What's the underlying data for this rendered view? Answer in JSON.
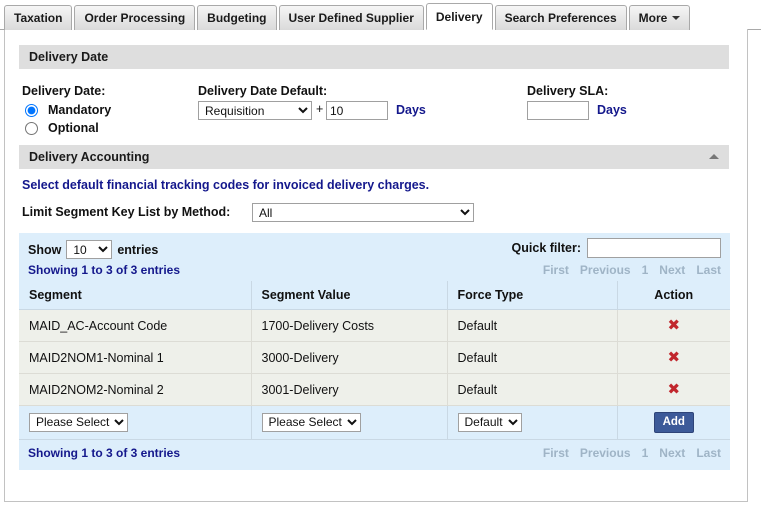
{
  "tabs": [
    {
      "label": "Taxation",
      "active": false
    },
    {
      "label": "Order Processing",
      "active": false
    },
    {
      "label": "Budgeting",
      "active": false
    },
    {
      "label": "User Defined Supplier",
      "active": false
    },
    {
      "label": "Delivery",
      "active": true
    },
    {
      "label": "Search Preferences",
      "active": false
    },
    {
      "label": "More",
      "active": false,
      "has_caret": true
    }
  ],
  "delivery_date_section": {
    "title": "Delivery Date",
    "delivery_date_label": "Delivery Date:",
    "radio_mandatory_label": "Mandatory",
    "radio_optional_label": "Optional",
    "selected_option": "Mandatory",
    "default_label": "Delivery Date Default:",
    "default_value": "Requisition",
    "default_options": [
      "Requisition"
    ],
    "plus_sign": "+",
    "days_offset_value": "10",
    "days_label": "Days",
    "sla_label": "Delivery SLA:",
    "sla_value": "",
    "sla_days_label": "Days"
  },
  "delivery_accounting_section": {
    "title": "Delivery Accounting",
    "collapse_icon": "triangle-up-icon",
    "intro_text": "Select default financial tracking codes for invoiced delivery charges.",
    "limit_label": "Limit Segment Key List by Method:",
    "limit_value": "All",
    "limit_options": [
      "All"
    ]
  },
  "table": {
    "show_prefix": "Show",
    "show_suffix": "entries",
    "page_length": "10",
    "page_length_options": [
      "10"
    ],
    "quick_filter_label": "Quick filter:",
    "quick_filter_value": "",
    "showing_text": "Showing 1 to 3 of 3 entries",
    "pager": [
      "First",
      "Previous",
      "1",
      "Next",
      "Last"
    ],
    "columns": [
      "Segment",
      "Segment Value",
      "Force Type",
      "Action"
    ],
    "rows": [
      {
        "segment": "MAID_AC-Account Code",
        "segment_value": "1700-Delivery Costs",
        "force_type": "Default",
        "action_icon": "delete-x-icon"
      },
      {
        "segment": "MAID2NOM1-Nominal 1",
        "segment_value": "3000-Delivery",
        "force_type": "Default",
        "action_icon": "delete-x-icon"
      },
      {
        "segment": "MAID2NOM2-Nominal 2",
        "segment_value": "3001-Delivery",
        "force_type": "Default",
        "action_icon": "delete-x-icon"
      }
    ],
    "new_row": {
      "segment_value": "Please Select",
      "segment_options": [
        "Please Select"
      ],
      "segment_value_value": "Please Select",
      "segment_value_options": [
        "Please Select"
      ],
      "force_type_value": "Default",
      "force_type_options": [
        "Default"
      ],
      "add_label": "Add"
    }
  },
  "colors": {
    "accent_blue": "#14188c",
    "table_header_blue": "#ddeefb",
    "row_bg": "#eef0ea",
    "delete_red": "#c1272d",
    "add_button_blue": "#3c5a99",
    "section_header_gray": "#dedede"
  }
}
